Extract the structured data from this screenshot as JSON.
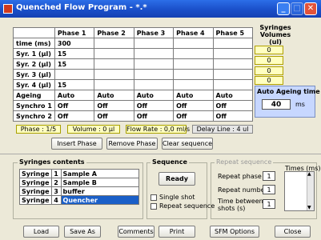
{
  "window": {
    "title": "Quenched Flow Program - *.*"
  },
  "grid": {
    "headers": [
      "",
      "Phase 1",
      "Phase 2",
      "Phase 3",
      "Phase 4",
      "Phase 5"
    ],
    "rows": [
      {
        "label": "time (ms)",
        "cells": [
          "300",
          "",
          "",
          "",
          ""
        ]
      },
      {
        "label": "Syr. 1 (µl)",
        "cells": [
          "15",
          "",
          "",
          "",
          ""
        ]
      },
      {
        "label": "Syr. 2 (µl)",
        "cells": [
          "15",
          "",
          "",
          "",
          ""
        ]
      },
      {
        "label": "Syr. 3 (µl)",
        "cells": [
          "",
          "",
          "",
          "",
          ""
        ]
      },
      {
        "label": "Syr. 4 (µl)",
        "cells": [
          "15",
          "",
          "",
          "",
          ""
        ]
      },
      {
        "label": "Ageing",
        "cells": [
          "Auto",
          "Auto",
          "Auto",
          "Auto",
          "Auto"
        ]
      },
      {
        "label": "Synchro 1",
        "cells": [
          "Off",
          "Off",
          "Off",
          "Off",
          "Off"
        ]
      },
      {
        "label": "Synchro 2",
        "cells": [
          "Off",
          "Off",
          "Off",
          "Off",
          "Off"
        ]
      }
    ]
  },
  "volumes": {
    "title1": "Syringes",
    "title2": "Volumes",
    "title3": "(ul)",
    "values": [
      "0",
      "0",
      "0",
      "0"
    ]
  },
  "ageing": {
    "title": "Auto Ageing time",
    "value": "40",
    "unit": "ms"
  },
  "status": {
    "phase": "Phase : 1/5",
    "volume": "Volume : 0 µl",
    "flow": "Flow Rate : 0,0 ml/s",
    "delay": "Delay Line : 4 ul"
  },
  "actions": {
    "insert": "Insert Phase",
    "remove": "Remove Phase",
    "clear": "Clear sequence"
  },
  "syringes_contents": {
    "title": "Syringes contents",
    "items": [
      {
        "label": "Syringe",
        "num": "1",
        "name": "Sample A"
      },
      {
        "label": "Syringe",
        "num": "2",
        "name": "Sample B"
      },
      {
        "label": "Syringe",
        "num": "3",
        "name": "buffer"
      },
      {
        "label": "Syringe",
        "num": "4",
        "name": "Quencher"
      }
    ]
  },
  "sequence": {
    "title": "Sequence",
    "ready": "Ready",
    "single_shot": "Single shot",
    "repeat_sequence": "Repeat sequence"
  },
  "repeat": {
    "title": "Repeat sequence",
    "phase_label": "Repeat phase",
    "phase_value": "1",
    "number_label": "Repeat number",
    "number_value": "1",
    "time_label1": "Time between",
    "time_label2": "shots (s)",
    "time_value": "1",
    "times_label": "Times (ms)"
  },
  "footer": {
    "load": "Load",
    "save_as": "Save As",
    "comments": "Comments",
    "print": "Print",
    "sfm": "SFM Options",
    "close": "Close"
  }
}
